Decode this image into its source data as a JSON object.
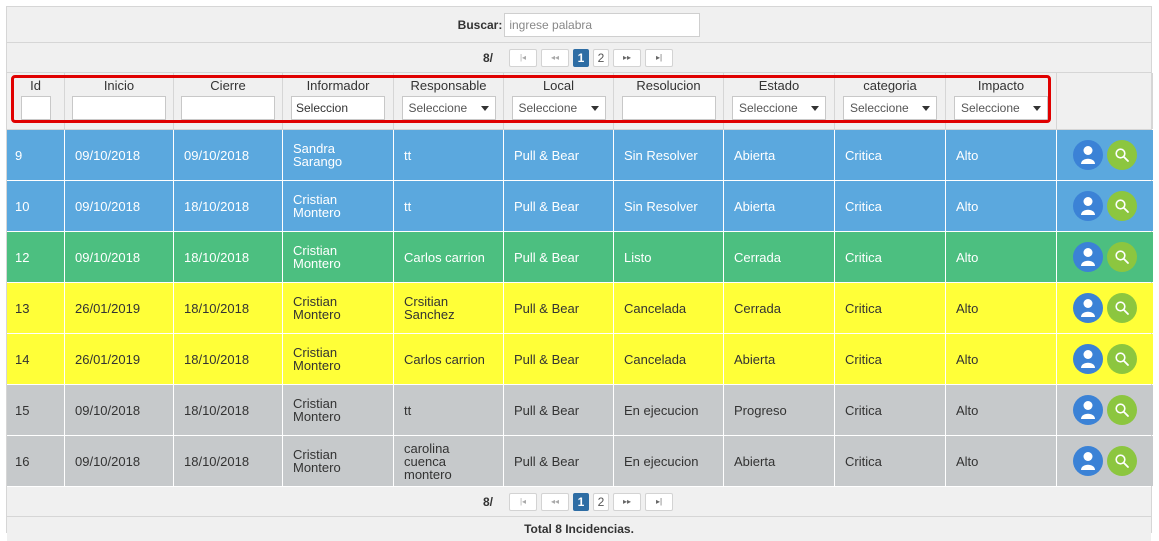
{
  "search": {
    "label": "Buscar:",
    "placeholder": "ingrese palabra"
  },
  "pager": {
    "text": "8/",
    "first": "|◂",
    "prev": "◂◂",
    "pages": [
      "1",
      "2"
    ],
    "next": "▸▸",
    "last": "▸|"
  },
  "columns": [
    "Id",
    "Inicio",
    "Cierre",
    "Informador",
    "Responsable",
    "Local",
    "Resolucion",
    "Estado",
    "categoria",
    "Impacto"
  ],
  "filters": {
    "informador_value": "Seleccion",
    "select_label": "Seleccione"
  },
  "rows": [
    {
      "id": "9",
      "inicio": "09/10/2018",
      "cierre": "09/10/2018",
      "informador": [
        "Sandra",
        "Sarango"
      ],
      "responsable": [
        "tt"
      ],
      "local": "Pull & Bear",
      "resolucion": "Sin Resolver",
      "estado": "Abierta",
      "categoria": "Critica",
      "impacto": "Alto",
      "color": "blue"
    },
    {
      "id": "10",
      "inicio": "09/10/2018",
      "cierre": "18/10/2018",
      "informador": [
        "Cristian",
        "Montero"
      ],
      "responsable": [
        "tt"
      ],
      "local": "Pull & Bear",
      "resolucion": "Sin Resolver",
      "estado": "Abierta",
      "categoria": "Critica",
      "impacto": "Alto",
      "color": "blue"
    },
    {
      "id": "12",
      "inicio": "09/10/2018",
      "cierre": "18/10/2018",
      "informador": [
        "Cristian",
        "Montero"
      ],
      "responsable": [
        "Carlos carrion"
      ],
      "local": "Pull & Bear",
      "resolucion": "Listo",
      "estado": "Cerrada",
      "categoria": "Critica",
      "impacto": "Alto",
      "color": "green"
    },
    {
      "id": "13",
      "inicio": "26/01/2019",
      "cierre": "18/10/2018",
      "informador": [
        "Cristian",
        "Montero"
      ],
      "responsable": [
        "Crsitian",
        "Sanchez"
      ],
      "local": "Pull & Bear",
      "resolucion": "Cancelada",
      "estado": "Cerrada",
      "categoria": "Critica",
      "impacto": "Alto",
      "color": "yellow"
    },
    {
      "id": "14",
      "inicio": "26/01/2019",
      "cierre": "18/10/2018",
      "informador": [
        "Cristian",
        "Montero"
      ],
      "responsable": [
        "Carlos carrion"
      ],
      "local": "Pull & Bear",
      "resolucion": "Cancelada",
      "estado": "Abierta",
      "categoria": "Critica",
      "impacto": "Alto",
      "color": "yellow"
    },
    {
      "id": "15",
      "inicio": "09/10/2018",
      "cierre": "18/10/2018",
      "informador": [
        "Cristian",
        "Montero"
      ],
      "responsable": [
        "tt"
      ],
      "local": "Pull & Bear",
      "resolucion": "En ejecucion",
      "estado": "Progreso",
      "categoria": "Critica",
      "impacto": "Alto",
      "color": "gray"
    },
    {
      "id": "16",
      "inicio": "09/10/2018",
      "cierre": "18/10/2018",
      "informador": [
        "Cristian",
        "Montero"
      ],
      "responsable": [
        "carolina",
        "cuenca",
        "montero"
      ],
      "local": "Pull & Bear",
      "resolucion": "En ejecucion",
      "estado": "Abierta",
      "categoria": "Critica",
      "impacto": "Alto",
      "color": "gray"
    }
  ],
  "icons": {
    "user": "user-icon",
    "view": "search-icon"
  },
  "colors": {
    "blue": "#5ba8de",
    "green": "#4cbf80",
    "yellow": "#ffff38",
    "gray": "#c6c9cb",
    "highlight": "#e00000",
    "pager_active": "#2e6da4"
  },
  "total": "Total 8 Incidencias."
}
